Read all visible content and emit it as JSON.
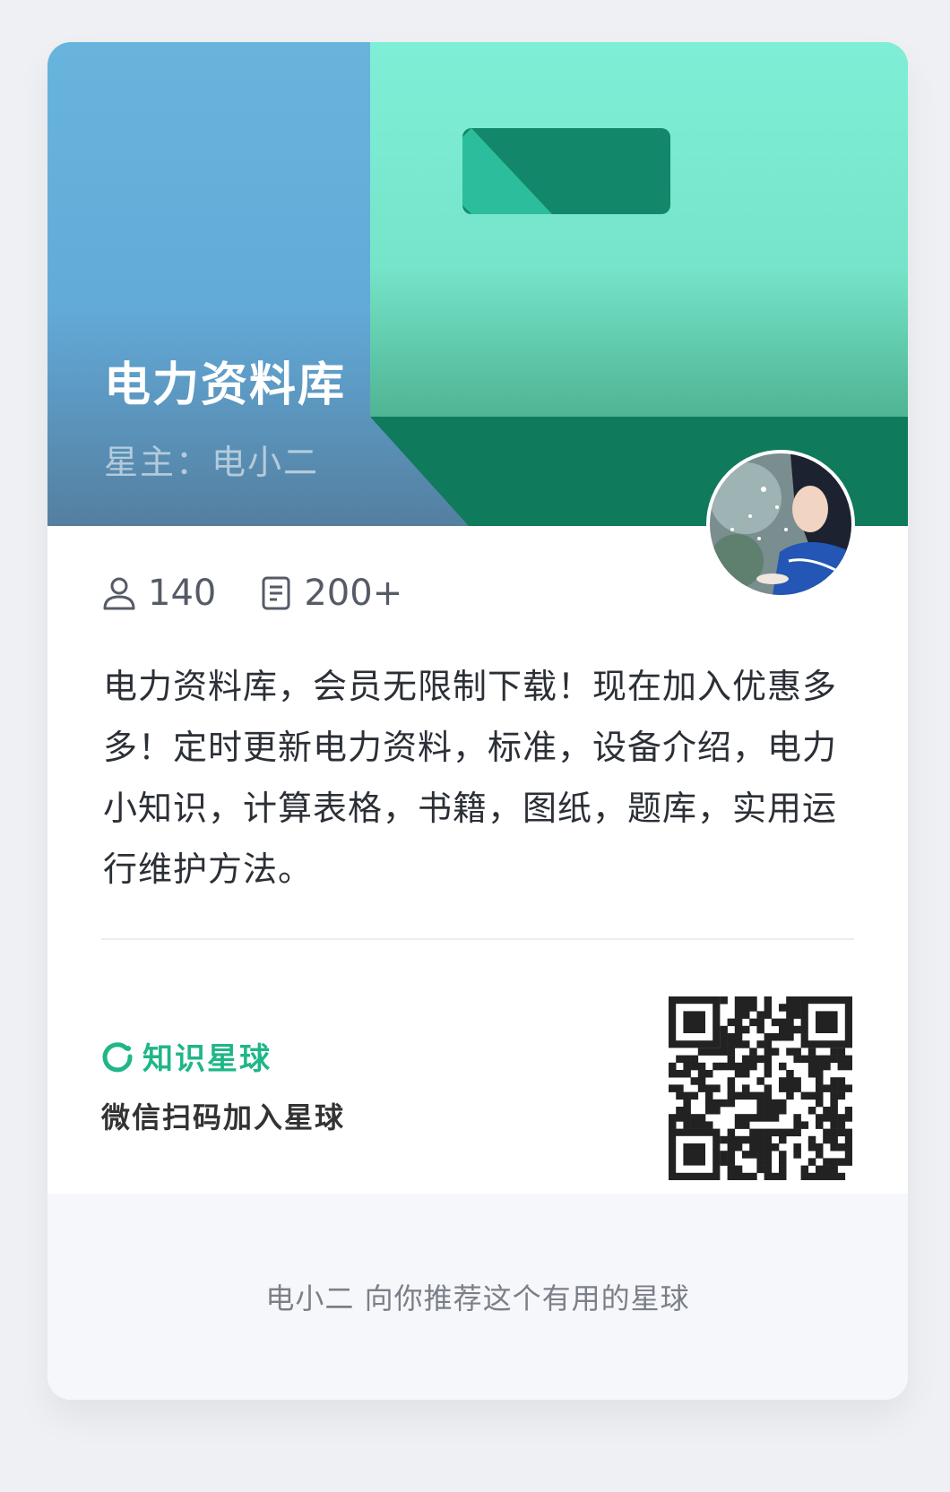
{
  "banner": {
    "title": "电力资料库",
    "owner": "星主：电小二"
  },
  "stats": {
    "members": "140",
    "posts": "200+"
  },
  "description": "电力资料库，会员无限制下载！现在加入优惠多多！定时更新电力资料，标准，设备介绍，电力小知识，计算表格，书籍，图纸，题库，实用运行维护方法。",
  "brand": {
    "name": "知识星球",
    "scan_text": "微信扫码加入星球"
  },
  "footer": {
    "text": "电小二 向你推荐这个有用的星球"
  },
  "colors": {
    "brand_green": "#1fb688",
    "banner_blue": "#62aad8",
    "banner_teal": "#7eecd4",
    "banner_dark_green": "#0f8a63"
  },
  "icons": {
    "members": "user-icon",
    "posts": "document-icon",
    "brand": "zsxq-logo-icon"
  }
}
